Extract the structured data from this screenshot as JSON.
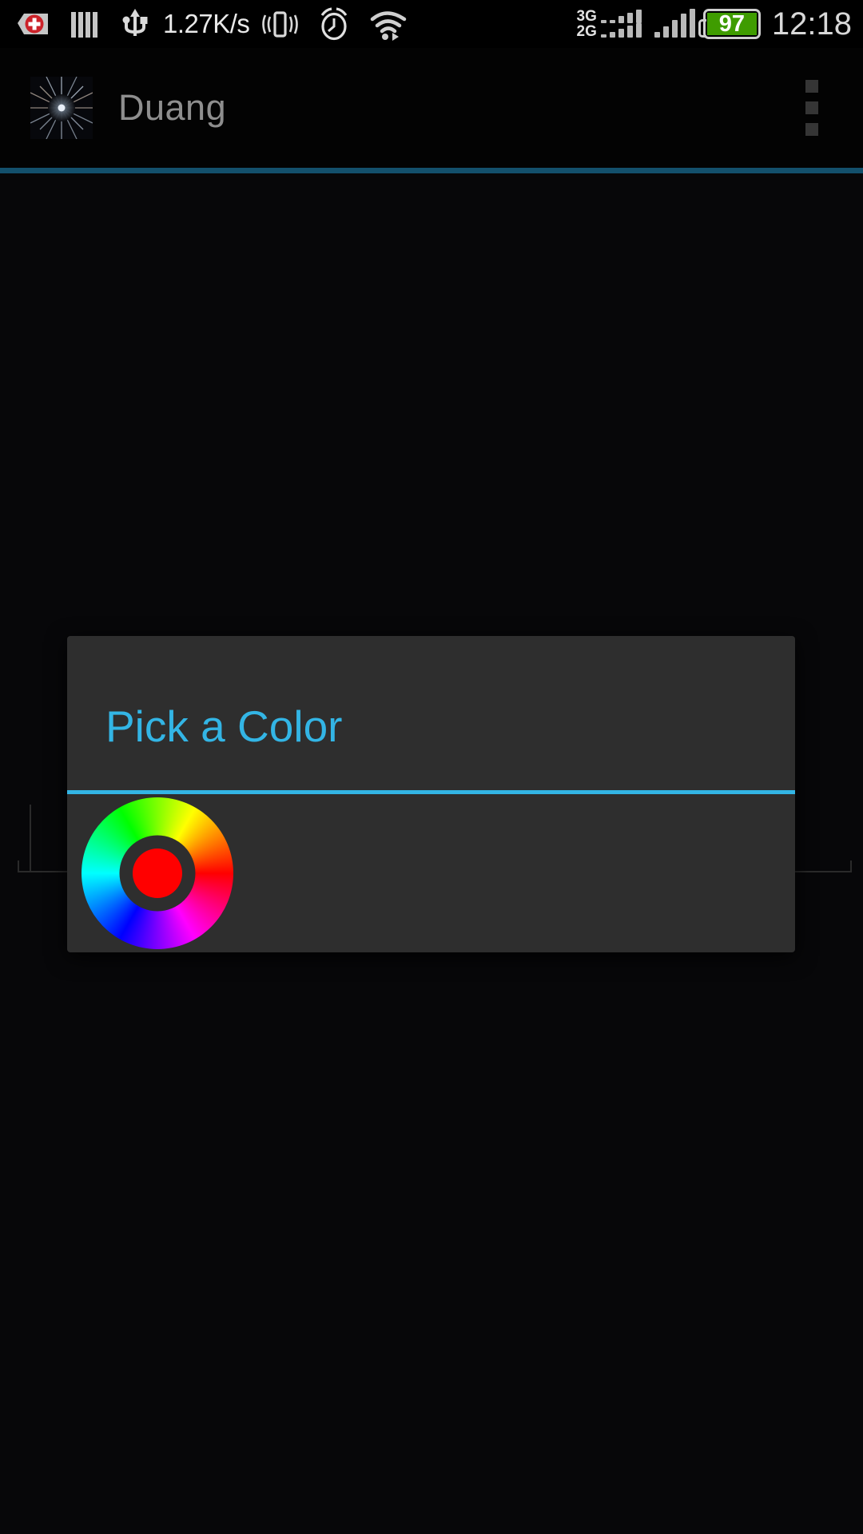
{
  "status_bar": {
    "net_speed": "1.27K/s",
    "clock": "12:18",
    "battery_level": "97",
    "battery_color": "#3f9c00",
    "network_labels": [
      "3G",
      "2G"
    ],
    "icons": [
      {
        "name": "medical-add-icon",
        "label": "+"
      },
      {
        "name": "barcode-icon",
        "label": ""
      },
      {
        "name": "usb-icon",
        "label": ""
      },
      {
        "name": "vibrate-icon",
        "label": ""
      },
      {
        "name": "alarm-clock-icon",
        "label": ""
      },
      {
        "name": "wifi-icon",
        "label": ""
      }
    ]
  },
  "action_bar": {
    "title": "Duang",
    "icon_name": "starburst-app-icon",
    "overflow_label": "",
    "underline_color": "#13506c"
  },
  "dialog": {
    "title": "Pick a Color",
    "accent_color": "#33b5e5",
    "background_color": "#2e2e2e",
    "selected_color": "#ff0000",
    "wheel_name": "hsv-color-wheel"
  }
}
